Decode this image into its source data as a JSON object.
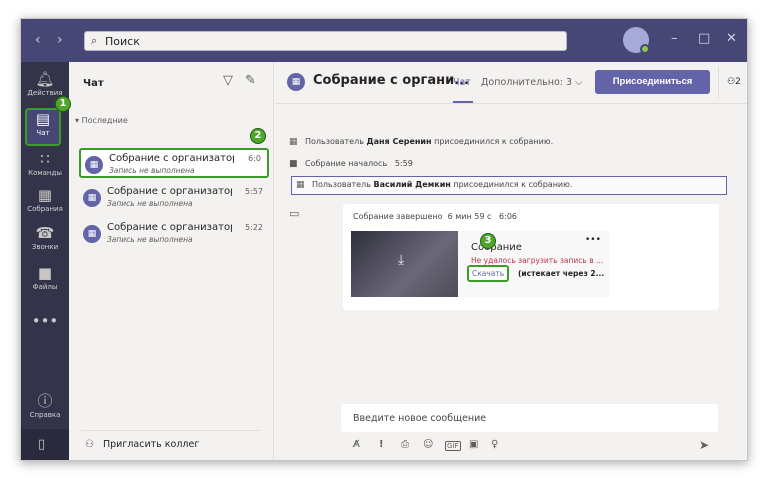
{
  "titlebar": {
    "back_icon": "chevron-left-icon",
    "forward_icon": "chevron-right-icon",
    "search_placeholder": "Поиск",
    "minimize_icon": "minimize-icon",
    "maximize_icon": "maximize-icon",
    "close_icon": "close-icon"
  },
  "rail": {
    "items": [
      {
        "label": "Действия",
        "icon": "bell-icon"
      },
      {
        "label": "Чат",
        "icon": "chat-icon"
      },
      {
        "label": "Команды",
        "icon": "teams-icon"
      },
      {
        "label": "Собрания",
        "icon": "calendar-icon"
      },
      {
        "label": "Звонки",
        "icon": "phone-icon"
      },
      {
        "label": "Файлы",
        "icon": "file-icon"
      }
    ],
    "more": "•••",
    "help_label": "Справка"
  },
  "badges": [
    "1",
    "2",
    "3"
  ],
  "chatlist": {
    "title": "Чат",
    "section": "Последние",
    "items": [
      {
        "name": "Собрание с организатор...",
        "sub": "Запись не выполнена",
        "time": "6:0"
      },
      {
        "name": "Собрание с организатор...",
        "sub": "Запись не выполнена",
        "time": "5:57"
      },
      {
        "name": "Собрание с организатор...",
        "sub": "Запись не выполнена",
        "time": "5:22"
      }
    ],
    "invite": "Пригласить коллег"
  },
  "header": {
    "title": "Собрание с органи...",
    "tab_chat": "Чат",
    "tab_more": "Дополнительно: 3 ⌵",
    "join": "Присоединиться",
    "participants": "2"
  },
  "events": [
    {
      "pre": "Пользователь ",
      "name": "Даня Серенин",
      "post": " присоединился к собранию."
    },
    {
      "text": "Собрание началось",
      "time": "5:59"
    },
    {
      "pre": "Пользователь ",
      "name": "Василий Демкин",
      "post": " присоединился к собранию."
    }
  ],
  "ended": {
    "text": "Собрание завершено",
    "duration": "6 мин 59 с",
    "time": "6:06"
  },
  "recording": {
    "title": "Собрание",
    "more": "•••",
    "error": "Не удалось загрузить запись в ...",
    "download": "Скачать",
    "expires": "(истекает через 2..."
  },
  "composer": {
    "placeholder": "Введите новое сообщение"
  }
}
